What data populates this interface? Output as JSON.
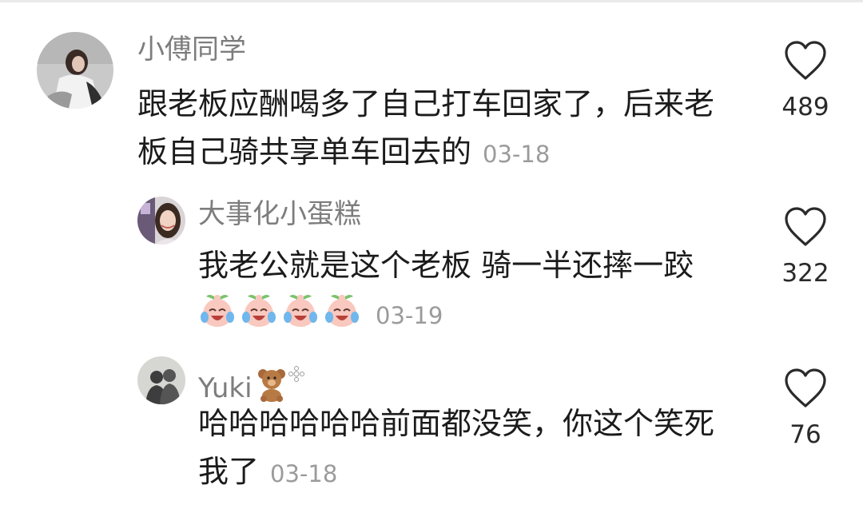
{
  "comments": [
    {
      "username": "小傅同学",
      "text": "跟老板应酬喝多了自己打车回家了，后来老板自己骑共享单车回去的",
      "date": "03-18",
      "likes": "489"
    },
    {
      "username": "大事化小蛋糕",
      "text": "我老公就是这个老板 骑一半还摔一跤",
      "emoji": [
        "crying-laughing-peach-icon",
        "crying-laughing-peach-icon",
        "crying-laughing-peach-icon",
        "crying-laughing-peach-icon"
      ],
      "date": "03-19",
      "likes": "322"
    },
    {
      "username": "Yuki",
      "username_badges": [
        "teddy-bear-icon",
        "flower-icon"
      ],
      "text": "哈哈哈哈哈哈前面都没笑，你这个笑死我了",
      "date": "03-18",
      "likes": "76"
    }
  ],
  "colors": {
    "username": "#7d7d7d",
    "text": "#1b1b1b",
    "date": "#9b9b9b",
    "like_outline": "#2a2a2a"
  }
}
